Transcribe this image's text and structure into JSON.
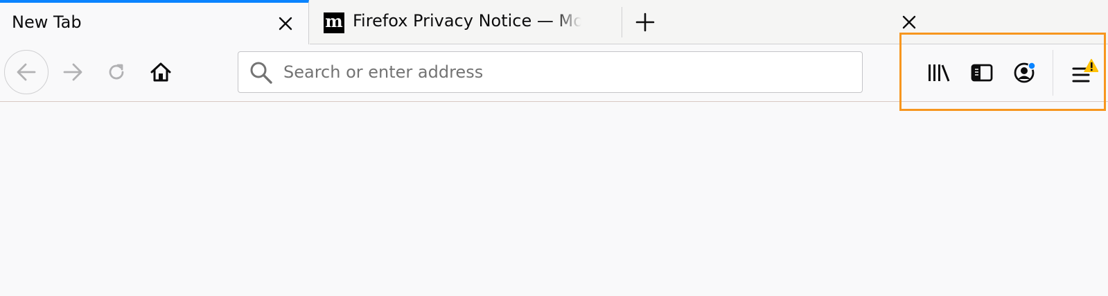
{
  "tabs": [
    {
      "title": "New Tab",
      "active": true
    },
    {
      "title": "Firefox Privacy Notice — Mozilla",
      "favicon": "m",
      "active": false
    }
  ],
  "toolbar": {
    "back_icon": "arrow-left-icon",
    "forward_icon": "arrow-right-icon",
    "reload_icon": "reload-icon",
    "home_icon": "home-icon",
    "search_placeholder": "Search or enter address",
    "search_value": "",
    "library_icon": "library-icon",
    "sidebar_icon": "sidebar-icon",
    "account_icon": "account-icon",
    "menu_icon": "hamburger-menu-icon"
  },
  "colors": {
    "accent": "#0a84ff",
    "highlight": "#f7961e",
    "warning": "#ffc107",
    "notification_dot": "#0a84ff"
  }
}
